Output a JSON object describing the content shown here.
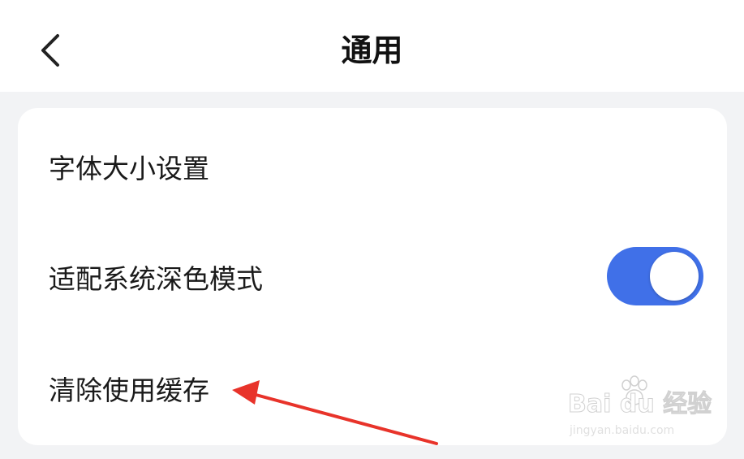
{
  "header": {
    "title": "通用",
    "back_icon": "chevron-left-icon"
  },
  "settings": {
    "items": [
      {
        "label": "字体大小设置"
      },
      {
        "label": "适配系统深色模式",
        "toggle_on": true
      },
      {
        "label": "清除使用缓存"
      }
    ]
  },
  "colors": {
    "toggle_on": "#4070e8",
    "annotation_arrow": "#e8332a",
    "content_background": "#f2f3f5"
  },
  "watermark": {
    "brand": "Bai du 经验",
    "url": "jingyan.baidu.com"
  }
}
